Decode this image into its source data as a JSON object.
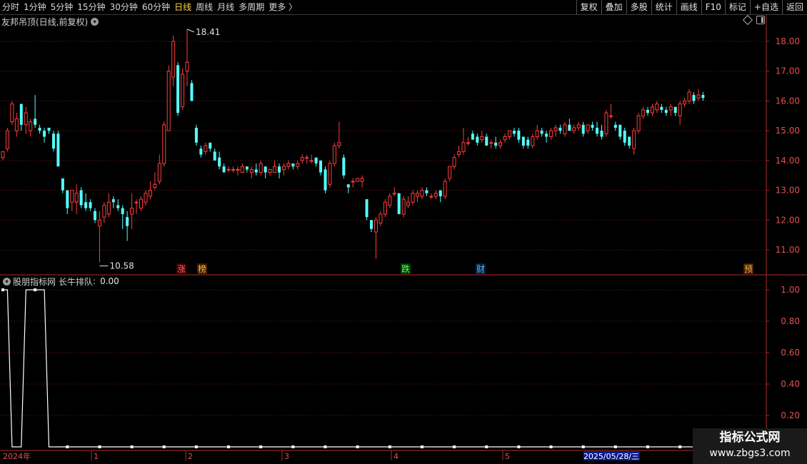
{
  "toolbar": {
    "periods": [
      "分时",
      "1分钟",
      "5分钟",
      "15分钟",
      "30分钟",
      "60分钟",
      "日线",
      "周线",
      "月线",
      "多周期",
      "更多 〉"
    ],
    "active_period": "日线",
    "buttons": [
      "复权",
      "叠加",
      "多股",
      "统计",
      "画线",
      "F10",
      "标记",
      "+自选",
      "返回"
    ]
  },
  "price_panel": {
    "title": "友邦吊顶(日线,前复权)",
    "y_ticks": [
      "18.00",
      "17.00",
      "16.00",
      "15.00",
      "14.00",
      "13.00",
      "12.00",
      "11.00"
    ],
    "high_label": "18.41",
    "low_label": "10.58",
    "markers": [
      "涨",
      "榜",
      "跌",
      "财",
      "预"
    ]
  },
  "indicator_panel": {
    "source": "股朋指标网",
    "name": "长牛排队",
    "value_text": "0.00",
    "y_ticks": [
      "1.00",
      "0.80",
      "0.60",
      "0.40",
      "0.20"
    ]
  },
  "x_axis": {
    "year_label": "2024年",
    "month_labels": [
      "1",
      "2",
      "3",
      "4",
      "5"
    ],
    "cursor_date": "2025/05/28/三"
  },
  "watermark": {
    "title": "指标公式网",
    "url": "www.zbgs3.com"
  },
  "colors": {
    "up": "#ff3d3d",
    "down": "#54ffff",
    "axis": "#b02a2a",
    "active_tab": "#ffd34d"
  },
  "chart_data": [
    {
      "type": "candlestick",
      "ylim": [
        10.3,
        18.9
      ],
      "candles": [
        [
          14.1,
          14.3,
          14.0,
          14.3
        ],
        [
          14.4,
          15.1,
          14.3,
          15.0
        ],
        [
          15.3,
          16.0,
          15.2,
          15.9
        ],
        [
          15.0,
          15.6,
          14.8,
          15.4
        ],
        [
          15.9,
          15.9,
          15.0,
          15.2
        ],
        [
          15.2,
          15.8,
          14.9,
          15.6
        ],
        [
          15.0,
          15.4,
          14.8,
          15.3
        ],
        [
          15.4,
          16.2,
          15.1,
          15.2
        ],
        [
          15.1,
          15.2,
          14.9,
          15.0
        ],
        [
          15.0,
          15.1,
          14.6,
          14.8
        ],
        [
          15.1,
          15.1,
          14.9,
          15.0
        ],
        [
          14.9,
          15.0,
          14.3,
          14.4
        ],
        [
          14.9,
          15.0,
          13.8,
          13.8
        ],
        [
          13.4,
          13.4,
          12.9,
          13.0
        ],
        [
          13.0,
          13.0,
          12.2,
          12.4
        ],
        [
          12.6,
          13.0,
          12.3,
          13.0
        ],
        [
          12.6,
          13.2,
          12.2,
          12.9
        ],
        [
          13.0,
          13.1,
          12.4,
          12.5
        ],
        [
          12.6,
          12.9,
          12.3,
          12.4
        ],
        [
          12.6,
          12.7,
          12.3,
          12.4
        ],
        [
          12.3,
          12.4,
          11.9,
          12.0
        ],
        [
          11.8,
          12.3,
          10.58,
          12.0
        ],
        [
          12.1,
          12.6,
          11.9,
          12.5
        ],
        [
          12.2,
          12.9,
          12.1,
          12.6
        ],
        [
          12.7,
          12.8,
          12.4,
          12.6
        ],
        [
          12.5,
          12.7,
          12.3,
          12.4
        ],
        [
          12.4,
          12.5,
          11.7,
          12.2
        ],
        [
          12.1,
          12.3,
          11.3,
          11.8
        ],
        [
          12.2,
          12.9,
          11.7,
          12.4
        ],
        [
          12.6,
          12.7,
          12.2,
          12.6
        ],
        [
          12.4,
          12.8,
          12.3,
          12.7
        ],
        [
          12.6,
          13.0,
          12.5,
          12.9
        ],
        [
          12.8,
          13.3,
          12.7,
          13.0
        ],
        [
          13.1,
          13.6,
          13.0,
          13.2
        ],
        [
          13.3,
          14.2,
          13.2,
          13.9
        ],
        [
          13.9,
          15.3,
          13.8,
          15.2
        ],
        [
          15.0,
          17.2,
          15.0,
          17.0
        ],
        [
          16.8,
          18.2,
          16.5,
          18.0
        ],
        [
          17.2,
          17.3,
          15.5,
          15.6
        ],
        [
          15.8,
          17.1,
          15.7,
          16.9
        ],
        [
          17.0,
          18.41,
          16.5,
          17.3
        ],
        [
          16.6,
          16.7,
          16.0,
          16.0
        ],
        [
          15.1,
          15.2,
          14.5,
          14.6
        ],
        [
          14.4,
          14.5,
          14.1,
          14.2
        ],
        [
          14.3,
          14.6,
          14.2,
          14.5
        ],
        [
          14.6,
          14.6,
          14.3,
          14.4
        ],
        [
          14.3,
          14.4,
          14.0,
          14.0
        ],
        [
          14.1,
          14.3,
          13.7,
          13.8
        ],
        [
          13.8,
          13.9,
          13.6,
          13.6
        ],
        [
          13.7,
          13.8,
          13.6,
          13.7
        ],
        [
          13.7,
          13.8,
          13.6,
          13.7
        ],
        [
          13.7,
          13.8,
          13.5,
          13.7
        ],
        [
          13.6,
          13.9,
          13.6,
          13.8
        ],
        [
          13.8,
          13.8,
          13.6,
          13.7
        ],
        [
          13.6,
          13.8,
          13.4,
          13.7
        ],
        [
          13.7,
          13.9,
          13.5,
          13.6
        ],
        [
          13.6,
          14.0,
          13.5,
          13.9
        ],
        [
          13.8,
          13.8,
          13.4,
          13.6
        ],
        [
          13.6,
          13.7,
          13.5,
          13.7
        ],
        [
          13.6,
          14.0,
          13.6,
          13.8
        ],
        [
          13.8,
          13.9,
          13.4,
          13.6
        ],
        [
          13.7,
          13.9,
          13.5,
          13.8
        ],
        [
          13.8,
          14.0,
          13.7,
          13.9
        ],
        [
          13.9,
          13.9,
          13.7,
          13.8
        ],
        [
          13.8,
          14.0,
          13.7,
          13.9
        ],
        [
          14.0,
          14.2,
          13.9,
          14.1
        ],
        [
          14.1,
          14.2,
          13.9,
          14.1
        ],
        [
          14.0,
          14.2,
          13.9,
          14.0
        ],
        [
          14.1,
          14.1,
          13.8,
          13.9
        ],
        [
          14.0,
          14.0,
          13.5,
          13.6
        ],
        [
          13.7,
          13.8,
          12.9,
          13.0
        ],
        [
          13.2,
          14.0,
          13.1,
          13.9
        ],
        [
          13.9,
          14.6,
          13.8,
          14.5
        ],
        [
          14.5,
          15.3,
          14.4,
          14.6
        ],
        [
          14.1,
          14.2,
          13.4,
          13.5
        ],
        [
          13.2,
          13.2,
          12.9,
          13.1
        ],
        [
          13.3,
          13.4,
          13.1,
          13.3
        ],
        [
          13.3,
          13.4,
          13.3,
          13.4
        ],
        [
          13.3,
          13.5,
          13.1,
          13.4
        ],
        [
          12.7,
          12.7,
          12.0,
          12.1
        ],
        [
          12.0,
          12.0,
          11.6,
          11.7
        ],
        [
          11.6,
          12.1,
          10.7,
          12.0
        ],
        [
          11.9,
          12.3,
          11.8,
          12.2
        ],
        [
          12.2,
          12.7,
          12.1,
          12.6
        ],
        [
          12.5,
          12.9,
          12.4,
          12.8
        ],
        [
          12.9,
          13.1,
          12.8,
          12.9
        ],
        [
          12.9,
          12.9,
          12.2,
          12.2
        ],
        [
          12.2,
          12.8,
          12.1,
          12.7
        ],
        [
          12.5,
          12.8,
          12.4,
          12.6
        ],
        [
          12.6,
          13.0,
          12.5,
          12.9
        ],
        [
          12.8,
          13.0,
          12.6,
          12.9
        ],
        [
          12.8,
          13.1,
          12.7,
          13.0
        ],
        [
          13.0,
          13.1,
          12.8,
          12.9
        ],
        [
          12.8,
          12.9,
          12.7,
          12.8
        ],
        [
          12.8,
          13.0,
          12.7,
          12.9
        ],
        [
          13.0,
          13.0,
          12.6,
          12.8
        ],
        [
          12.8,
          13.4,
          12.7,
          13.3
        ],
        [
          13.4,
          13.8,
          13.3,
          13.8
        ],
        [
          13.8,
          14.2,
          13.7,
          14.1
        ],
        [
          14.2,
          14.5,
          14.1,
          14.3
        ],
        [
          14.3,
          15.1,
          14.2,
          14.6
        ],
        [
          14.6,
          14.8,
          14.5,
          14.6
        ],
        [
          14.9,
          15.0,
          14.7,
          14.7
        ],
        [
          14.8,
          14.9,
          14.5,
          14.6
        ],
        [
          14.7,
          15.0,
          14.6,
          14.8
        ],
        [
          14.8,
          14.9,
          14.5,
          14.5
        ],
        [
          14.6,
          14.7,
          14.4,
          14.6
        ],
        [
          14.6,
          14.8,
          14.4,
          14.5
        ],
        [
          14.5,
          14.7,
          14.4,
          14.6
        ],
        [
          14.7,
          14.9,
          14.6,
          14.8
        ],
        [
          14.8,
          15.0,
          14.7,
          15.0
        ],
        [
          15.0,
          15.1,
          14.8,
          14.9
        ],
        [
          15.0,
          15.1,
          14.6,
          14.7
        ],
        [
          14.8,
          14.8,
          14.4,
          14.5
        ],
        [
          14.7,
          14.8,
          14.4,
          14.5
        ],
        [
          14.5,
          14.9,
          14.4,
          14.8
        ],
        [
          14.8,
          15.2,
          14.7,
          15.0
        ],
        [
          15.0,
          15.1,
          14.8,
          14.9
        ],
        [
          14.9,
          15.0,
          14.6,
          14.8
        ],
        [
          14.8,
          15.1,
          14.7,
          15.0
        ],
        [
          15.0,
          15.2,
          14.8,
          15.1
        ],
        [
          15.1,
          15.2,
          14.9,
          15.0
        ],
        [
          14.9,
          15.3,
          14.8,
          15.2
        ],
        [
          15.2,
          15.4,
          15.0,
          15.0
        ],
        [
          15.0,
          15.2,
          14.9,
          15.1
        ],
        [
          15.1,
          15.3,
          15.0,
          15.2
        ],
        [
          15.2,
          15.3,
          14.8,
          14.9
        ],
        [
          15.0,
          15.2,
          14.9,
          15.2
        ],
        [
          15.2,
          15.3,
          15.0,
          15.1
        ],
        [
          15.1,
          15.3,
          14.8,
          14.9
        ],
        [
          15.0,
          15.2,
          14.7,
          14.8
        ],
        [
          14.9,
          15.7,
          14.8,
          15.6
        ],
        [
          15.5,
          15.9,
          15.4,
          15.5
        ],
        [
          15.2,
          15.3,
          15.0,
          15.1
        ],
        [
          15.2,
          15.2,
          14.7,
          14.8
        ],
        [
          15.0,
          15.1,
          14.5,
          14.6
        ],
        [
          14.8,
          14.8,
          14.4,
          14.5
        ],
        [
          14.4,
          15.1,
          14.2,
          15.0
        ],
        [
          15.0,
          15.6,
          14.9,
          15.5
        ],
        [
          15.5,
          15.8,
          15.4,
          15.7
        ],
        [
          15.7,
          15.8,
          15.5,
          15.6
        ],
        [
          15.6,
          15.9,
          15.5,
          15.8
        ],
        [
          15.7,
          16.0,
          15.6,
          15.9
        ],
        [
          15.8,
          15.9,
          15.6,
          15.7
        ],
        [
          15.7,
          15.8,
          15.5,
          15.6
        ],
        [
          15.7,
          15.9,
          15.5,
          15.8
        ],
        [
          15.8,
          15.8,
          15.5,
          15.6
        ],
        [
          15.5,
          16.0,
          15.2,
          15.9
        ],
        [
          15.9,
          16.1,
          15.8,
          16.0
        ],
        [
          16.0,
          16.4,
          15.9,
          16.3
        ],
        [
          16.2,
          16.3,
          15.9,
          16.0
        ],
        [
          16.1,
          16.4,
          16.0,
          16.2
        ],
        [
          16.2,
          16.3,
          16.0,
          16.1
        ]
      ]
    },
    {
      "type": "line",
      "series_name": "长牛排队",
      "ylim": [
        0,
        1
      ],
      "values": [
        1,
        1,
        0,
        0,
        0,
        1,
        1,
        1,
        1,
        1,
        0,
        0,
        0,
        0,
        0,
        0,
        0,
        0,
        0,
        0,
        0,
        0,
        0,
        0,
        0,
        0,
        0,
        0,
        0,
        0,
        0,
        0,
        0,
        0,
        0,
        0,
        0,
        0,
        0,
        0,
        0,
        0,
        0,
        0,
        0,
        0,
        0,
        0,
        0,
        0,
        0,
        0,
        0,
        0,
        0,
        0,
        0,
        0,
        0,
        0,
        0,
        0,
        0,
        0,
        0,
        0,
        0,
        0,
        0,
        0,
        0,
        0,
        0,
        0,
        0,
        0,
        0,
        0,
        0,
        0,
        0,
        0,
        0,
        0,
        0,
        0,
        0,
        0,
        0,
        0,
        0,
        0,
        0,
        0,
        0,
        0,
        0,
        0,
        0,
        0,
        0,
        0,
        0,
        0,
        0,
        0,
        0,
        0,
        0,
        0,
        0,
        0,
        0,
        0,
        0,
        0,
        0,
        0,
        0,
        0,
        0,
        0,
        0,
        0,
        0,
        0,
        0,
        0,
        0,
        0,
        0,
        0,
        0,
        0,
        0,
        0,
        0,
        0,
        0,
        0,
        0,
        0,
        0,
        0,
        0,
        0,
        0,
        0,
        0,
        0,
        0,
        0,
        0,
        0,
        0,
        0,
        0,
        0,
        0,
        0,
        0,
        0
      ]
    }
  ]
}
